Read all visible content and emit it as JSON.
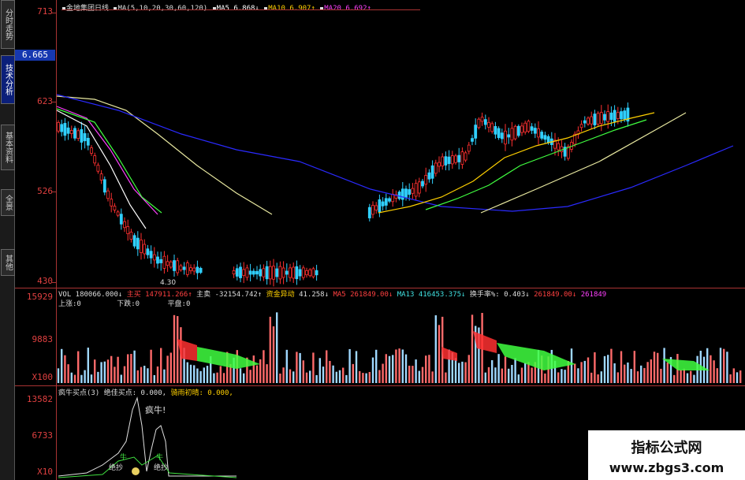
{
  "sidebar": {
    "tabs": [
      {
        "label": "分时走势",
        "active": false
      },
      {
        "label": "技术分析",
        "active": true
      },
      {
        "label": "基本资料",
        "active": false
      },
      {
        "label": "全景",
        "active": false
      },
      {
        "label": "其他",
        "active": false
      }
    ]
  },
  "axis": {
    "price_labels": [
      "713",
      "623",
      "526",
      "430"
    ],
    "current_price": "6.665",
    "volume_labels": [
      "15929",
      "9883",
      "X100"
    ],
    "indicator_labels": [
      "13582",
      "6733",
      "X10"
    ]
  },
  "header": {
    "stock": "金地集团日线",
    "ma_params": "MA(5,10,20,30,60,120)",
    "ma5": "MA5  6.868↓",
    "ma10": "MA10  6.907↑",
    "ma20": "MA20  6.692↑"
  },
  "volume_legend": {
    "vol": "VOL 180066.000↓",
    "zhumai_label": "主买",
    "zhumai": "147911.266↑",
    "zhumai2_label": "主卖",
    "zhumai2": "-32154.742↑",
    "flow_label": "资金异动",
    "flow": "41.258↓",
    "ma5_label": "MA5",
    "ma5": "261849.00↓",
    "ma13_label": "MA13",
    "ma13": "416453.375↓",
    "turnover_label": "换手率%:",
    "turnover": "0.403↓",
    "ma_extra": "261849.00↓",
    "ma_extra2": "261849"
  },
  "volume_sub": {
    "up": "上涨:0",
    "down": "下跌:0",
    "flat": "平盘:0"
  },
  "low_price": "4.30",
  "indicator": {
    "legend1": "疯牛买点(3)",
    "legend2": "绝佳买点: 0.000,",
    "legend3": "骑雨初晴: 0.000,",
    "annotation": "疯牛!",
    "tag_niu": "牛",
    "tag_juejia": "绝抄"
  },
  "watermark": {
    "title": "指标公式网",
    "url": "www.zbgs3.com"
  },
  "colors": {
    "up": "#ff3030",
    "down": "#30d0ff",
    "ma5": "#ffffff",
    "ma10": "#ffd000",
    "ma20": "#ff40ff",
    "ma30": "#40ff40",
    "ma60": "#e8e8a0",
    "ma120": "#2a2aff"
  }
}
